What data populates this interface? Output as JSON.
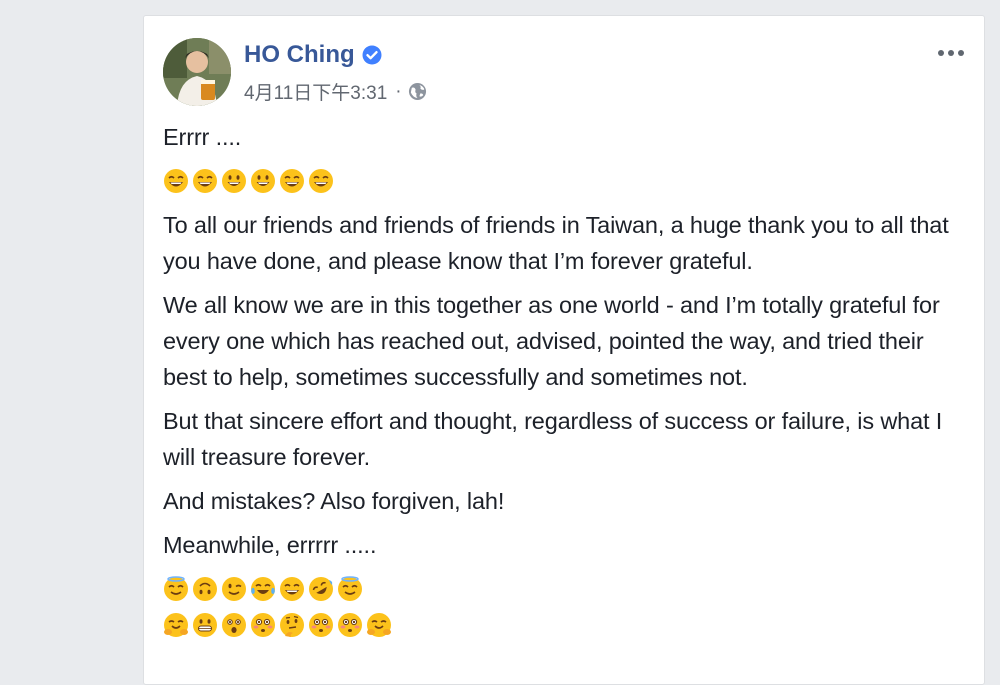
{
  "post": {
    "author": "HO Ching",
    "timestamp": "4月11日下午3:31",
    "separator": "·",
    "paragraphs": {
      "p1": "Errrr ....",
      "p2": "To all our friends and friends of friends in Taiwan, a huge thank you to all that you have done, and please know that I’m forever grateful.",
      "p3": "We all know we are in this together as one world - and I’m totally grateful for every one which has reached out, advised, pointed the way, and tried their best to help, sometimes successfully and sometimes not.",
      "p4": "But that sincere effort and thought, regardless of success or failure, is what I will treasure forever.",
      "p5": "And mistakes? Also forgiven, lah!",
      "p6": "Meanwhile, errrrr ....."
    },
    "emoji_row_1": [
      "grinning-squinting-face",
      "grinning-squinting-face",
      "smiling-face-open-mouth",
      "smiling-face-open-mouth",
      "grinning-squinting-face",
      "grinning-squinting-face"
    ],
    "emoji_row_2": [
      "smiling-face-halo",
      "upside-down-face",
      "winking-face",
      "tears-of-joy-face",
      "grinning-squinting-face",
      "rolling-on-floor-laughing-face",
      "smiling-face-halo"
    ],
    "emoji_row_3": [
      "hugging-face",
      "grimacing-face",
      "astonished-face",
      "flushed-face",
      "thinking-face",
      "flushed-face",
      "flushed-face",
      "hugging-face"
    ]
  },
  "icons": {
    "verified": "verified-badge-icon",
    "privacy": "globe-icon",
    "more": "more-options-icon"
  },
  "colors": {
    "page_bg": "#e9ebee",
    "card_bg": "#ffffff",
    "author_link": "#385898",
    "text": "#1d2129",
    "meta_text": "#616770",
    "verified_blue": "#4080ff",
    "emoji_yellow": "#fcc21b"
  }
}
